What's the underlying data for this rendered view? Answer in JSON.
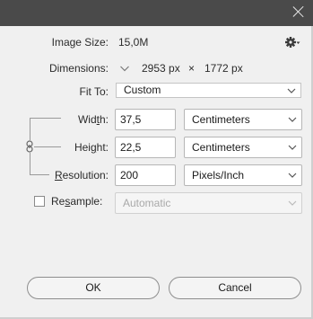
{
  "dialog": {
    "close_icon": "close-icon"
  },
  "image_size": {
    "label": "Image Size:",
    "value": "15,0M",
    "settings_icon": "gear-icon"
  },
  "dimensions": {
    "label": "Dimensions:",
    "width": "2953 px",
    "sep": "×",
    "height": "1772 px"
  },
  "fit_to": {
    "label": "Fit To:",
    "value": "Custom"
  },
  "width": {
    "label_pre": "Wid",
    "label_u": "t",
    "label_post": "h:",
    "value": "37,5",
    "unit": "Centimeters"
  },
  "height": {
    "label_pre": "Hei",
    "label_u": "g",
    "label_post": "ht:",
    "value": "22,5",
    "unit": "Centimeters"
  },
  "resolution": {
    "label_pre": "",
    "label_u": "R",
    "label_post": "esolution:",
    "value": "200",
    "unit": "Pixels/Inch"
  },
  "resample": {
    "label_pre": "Re",
    "label_u": "s",
    "label_post": "ample:",
    "checked": false,
    "value": "Automatic"
  },
  "buttons": {
    "ok": "OK",
    "cancel": "Cancel"
  },
  "colors": {
    "titlebar": "#4a4a4a",
    "background": "#f0f0f0"
  }
}
